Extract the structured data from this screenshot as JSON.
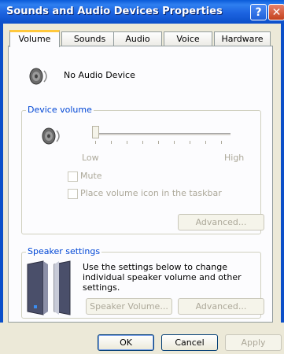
{
  "window": {
    "title": "Sounds and Audio Devices Properties",
    "help_label": "?",
    "close_label": "✕"
  },
  "tabs": [
    {
      "label": "Volume",
      "active": true
    },
    {
      "label": "Sounds",
      "active": false
    },
    {
      "label": "Audio",
      "active": false
    },
    {
      "label": "Voice",
      "active": false
    },
    {
      "label": "Hardware",
      "active": false
    }
  ],
  "device": {
    "name": "No Audio Device",
    "icon": "speaker-icon"
  },
  "device_volume": {
    "title": "Device volume",
    "low_label": "Low",
    "high_label": "High",
    "level": 0,
    "mute_label": "Mute",
    "taskbar_label": "Place volume icon in the taskbar",
    "advanced_label": "Advanced..."
  },
  "speaker_settings": {
    "title": "Speaker settings",
    "description": "Use the settings below to change individual speaker volume and other settings.",
    "speaker_volume_label": "Speaker Volume...",
    "advanced_label": "Advanced..."
  },
  "footer": {
    "ok_label": "OK",
    "cancel_label": "Cancel",
    "apply_label": "Apply"
  },
  "colors": {
    "title_bar": "#0b4fc9",
    "accent_tab": "#ffc83c",
    "group_title": "#0046d5",
    "disabled_text": "#aca899"
  }
}
